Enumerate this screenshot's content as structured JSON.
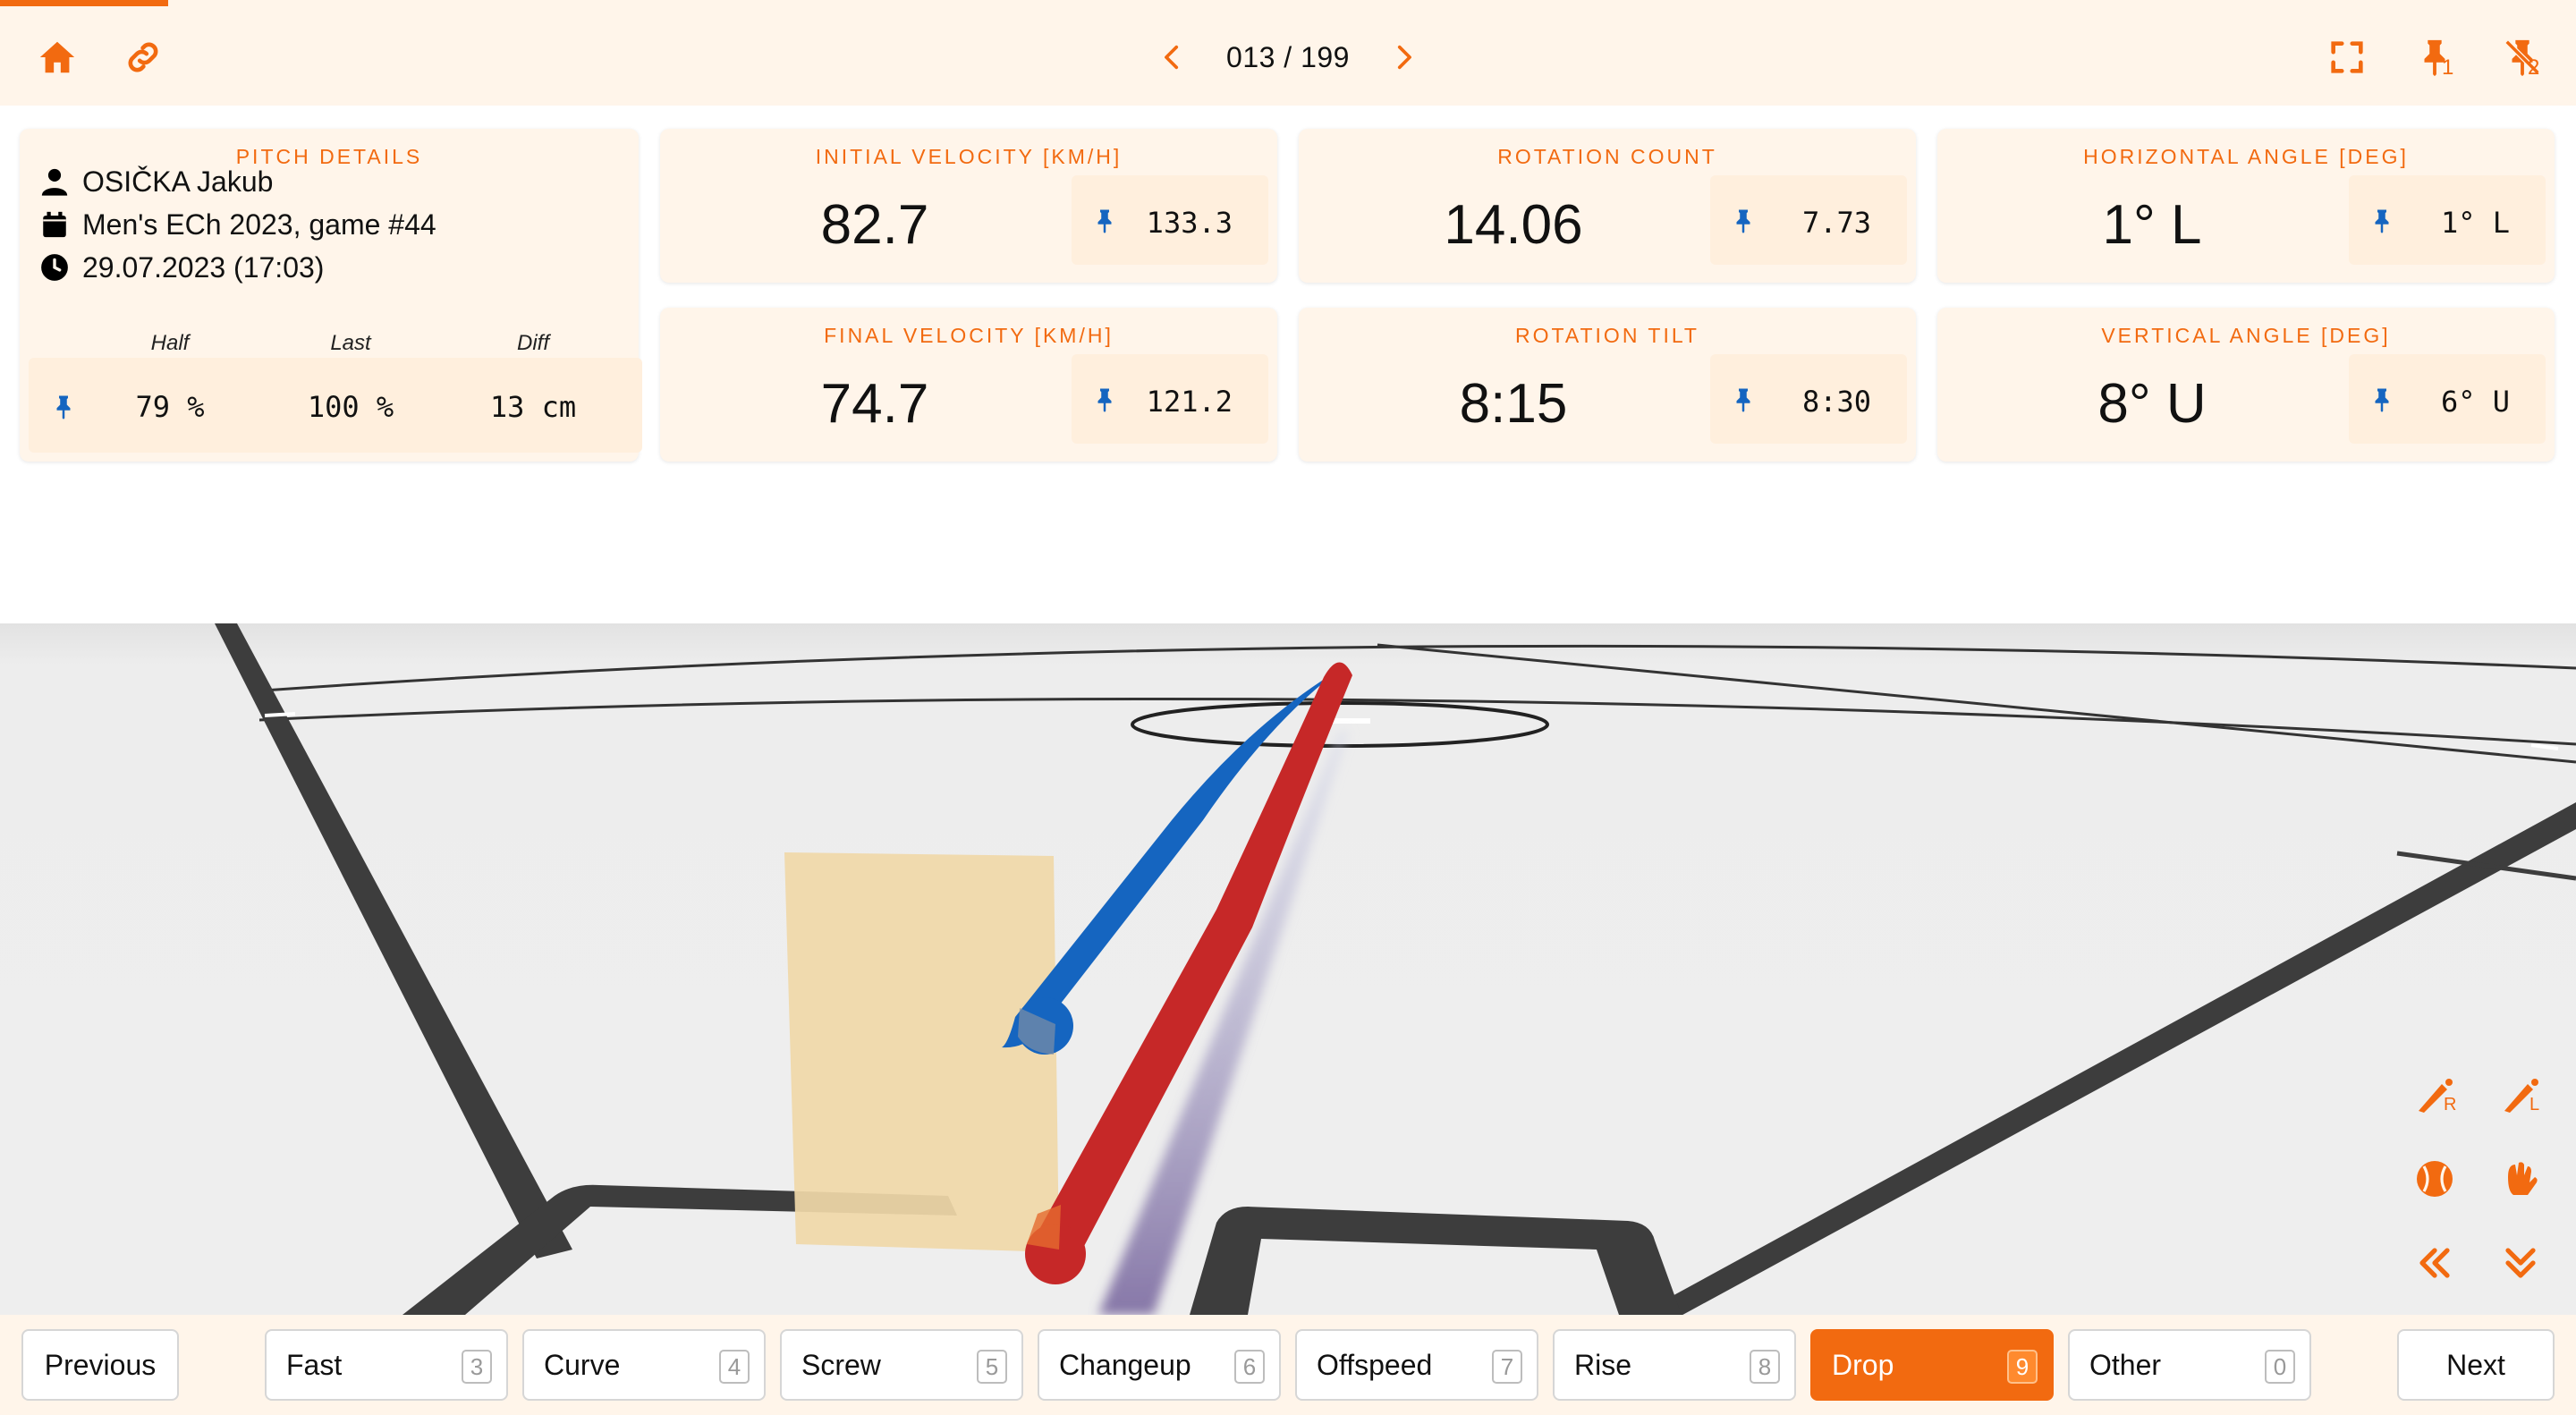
{
  "nav": {
    "counter": "013 / 199",
    "pin1_count": "1",
    "pin2_count": "2",
    "icons": [
      "home-icon",
      "link-icon",
      "chevron-left-icon",
      "chevron-right-icon",
      "fullscreen-icon",
      "pin-icon",
      "pin-off-icon"
    ]
  },
  "pitch_details": {
    "title": "PITCH DETAILS",
    "player": "OSIČKA Jakub",
    "game": "Men's ECh 2023, game #44",
    "datetime": "29.07.2023 (17:03)",
    "col_half": "Half",
    "col_last": "Last",
    "col_diff": "Diff",
    "val_half": "79 %",
    "val_last": "100 %",
    "val_diff": "13 cm"
  },
  "metrics": {
    "initial_velocity": {
      "title": "INITIAL VELOCITY [KM/H]",
      "value": "82.7",
      "pinned": "133.3"
    },
    "final_velocity": {
      "title": "FINAL VELOCITY [KM/H]",
      "value": "74.7",
      "pinned": "121.2"
    },
    "rotation_count": {
      "title": "ROTATION COUNT",
      "value": "14.06",
      "pinned": "7.73"
    },
    "rotation_tilt": {
      "title": "ROTATION TILT",
      "value": "8:15",
      "pinned": "8:30"
    },
    "horizontal_angle": {
      "title": "HORIZONTAL ANGLE [DEG]",
      "value": "1° L",
      "pinned": "1° L"
    },
    "vertical_angle": {
      "title": "VERTICAL ANGLE [DEG]",
      "value": "8° U",
      "pinned": "6° U"
    }
  },
  "side_tools": {
    "batter_right_sub": "R",
    "batter_left_sub": "L",
    "icons": [
      "batter-right-icon",
      "batter-left-icon",
      "ball-icon",
      "glove-icon",
      "double-left-icon",
      "double-down-icon"
    ]
  },
  "colors": {
    "accent": "#f26a10",
    "panel_bg": "#fff5ea",
    "current_pitch": "#c62828",
    "pinned_pitch": "#1565c0",
    "strike_zone": "#f0d8a8",
    "field": "#eeeeee",
    "lines": "#3d3d3d"
  },
  "footer": {
    "previous": "Previous",
    "next": "Next",
    "pitch_types": [
      {
        "label": "Fast",
        "key": "3",
        "active": false
      },
      {
        "label": "Curve",
        "key": "4",
        "active": false
      },
      {
        "label": "Screw",
        "key": "5",
        "active": false
      },
      {
        "label": "Changeup",
        "key": "6",
        "active": false
      },
      {
        "label": "Offspeed",
        "key": "7",
        "active": false
      },
      {
        "label": "Rise",
        "key": "8",
        "active": false
      },
      {
        "label": "Drop",
        "key": "9",
        "active": true
      },
      {
        "label": "Other",
        "key": "0",
        "active": false
      }
    ]
  }
}
